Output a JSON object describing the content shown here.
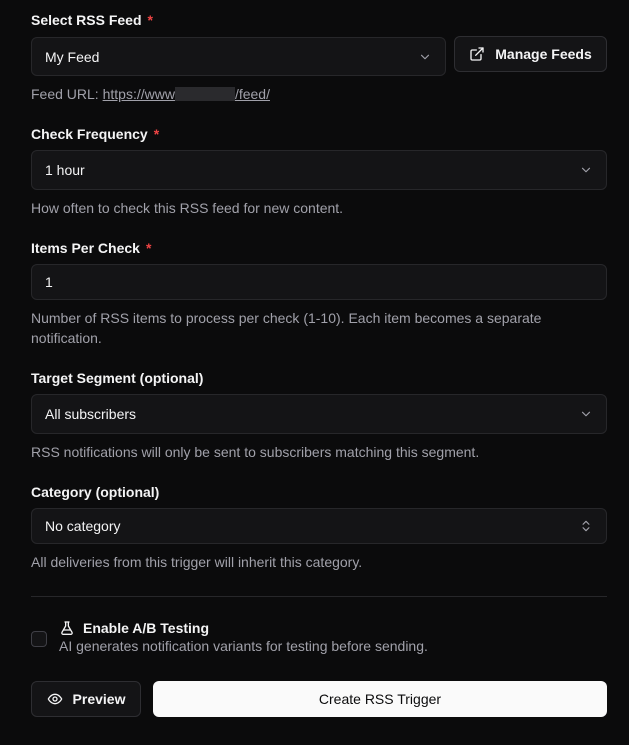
{
  "rss_feed": {
    "label": "Select RSS Feed",
    "required_mark": "*",
    "selected": "My Feed",
    "manage_label": "Manage Feeds",
    "url_prefix": "Feed URL: ",
    "url_start": "https://www",
    "url_end": "/feed/"
  },
  "frequency": {
    "label": "Check Frequency",
    "required_mark": "*",
    "selected": "1 hour",
    "help": "How often to check this RSS feed for new content."
  },
  "items_per_check": {
    "label": "Items Per Check",
    "required_mark": "*",
    "value": "1",
    "help_line1": "Number of RSS items to process per check (1-10). Each item becomes a separate",
    "help_line2": "notification."
  },
  "segment": {
    "label": "Target Segment (optional)",
    "selected": "All subscribers",
    "help": "RSS notifications will only be sent to subscribers matching this segment."
  },
  "category": {
    "label": "Category (optional)",
    "selected": "No category",
    "help": "All deliveries from this trigger will inherit this category."
  },
  "ab_testing": {
    "checked": false,
    "title": "Enable A/B Testing",
    "description": "AI generates notification variants for testing before sending."
  },
  "actions": {
    "preview_label": "Preview",
    "create_label": "Create RSS Trigger"
  },
  "colors": {
    "background": "#0b0b0c",
    "required": "#ef4444",
    "primary_button": "#fafafa"
  }
}
